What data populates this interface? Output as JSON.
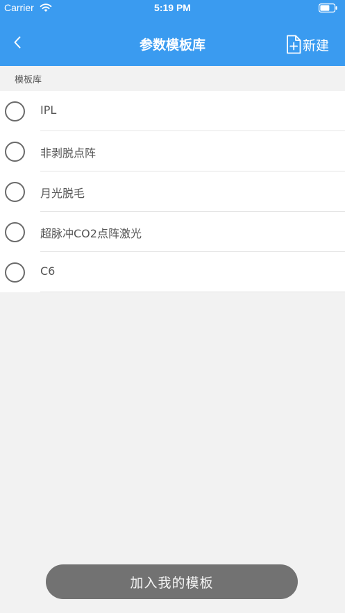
{
  "status_bar": {
    "carrier": "Carrier",
    "time": "5:19 PM"
  },
  "nav": {
    "title": "参数模板库",
    "new_label": "新建"
  },
  "section": {
    "title": "模板库"
  },
  "templates": [
    {
      "label": "IPL"
    },
    {
      "label": "非剥脱点阵"
    },
    {
      "label": "月光脱毛"
    },
    {
      "label": "超脉冲CO2点阵激光"
    },
    {
      "label": "C6"
    }
  ],
  "footer": {
    "add_label": "加入我的模板"
  },
  "colors": {
    "header_bg": "#3a9bf0",
    "page_bg": "#f2f2f2",
    "button_bg": "#727272"
  }
}
